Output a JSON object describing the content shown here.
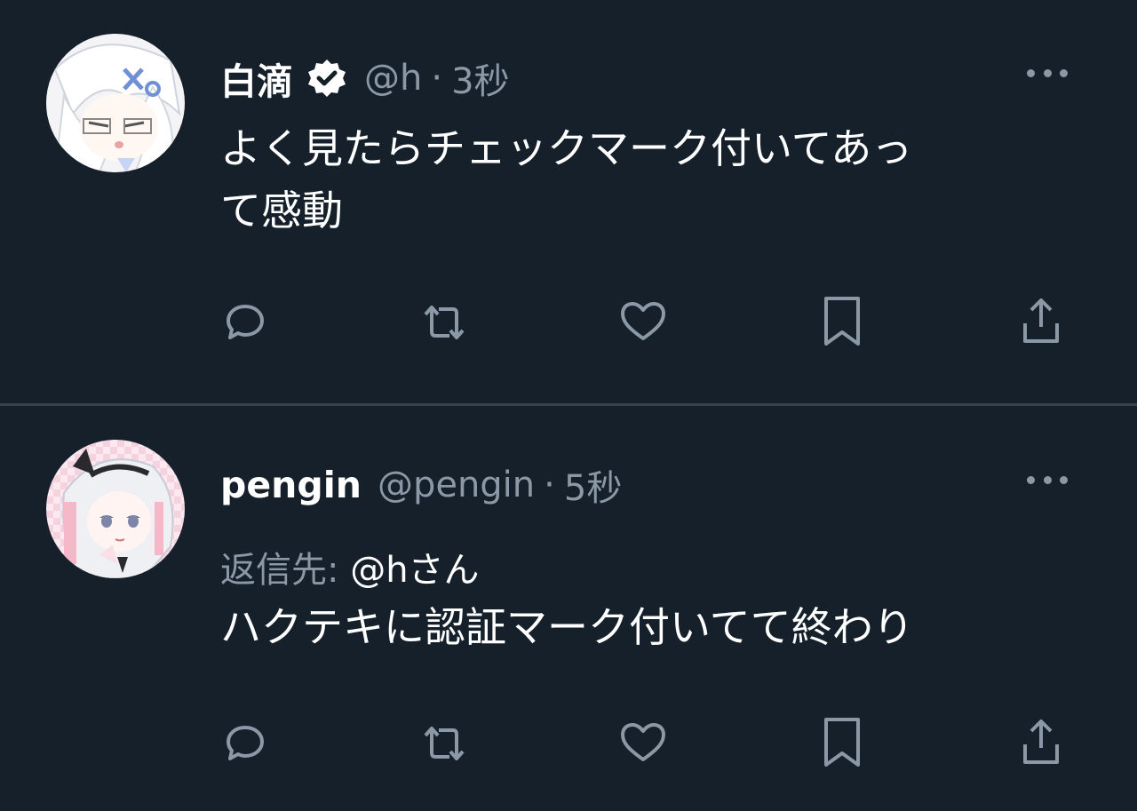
{
  "tweets": [
    {
      "display_name": "白滴",
      "verified": true,
      "handle": "@h",
      "separator": "·",
      "time": "3秒",
      "text": "よく見たらチェックマーク付いてあっ\nて感動",
      "reply_prefix": "",
      "reply_mention": ""
    },
    {
      "display_name": "pengin",
      "verified": false,
      "handle": "@pengin",
      "separator": "·",
      "time": "5秒",
      "text": "ハクテキに認証マーク付いてて終わり",
      "reply_prefix": "返信先: ",
      "reply_mention": "@hさん"
    }
  ],
  "actions": [
    "reply-icon",
    "retweet-icon",
    "like-icon",
    "bookmark-icon",
    "share-icon"
  ],
  "colors": {
    "background": "#15202b",
    "secondary_text": "#8b98a5",
    "divider": "#38444d",
    "primary_text": "#ffffff"
  }
}
